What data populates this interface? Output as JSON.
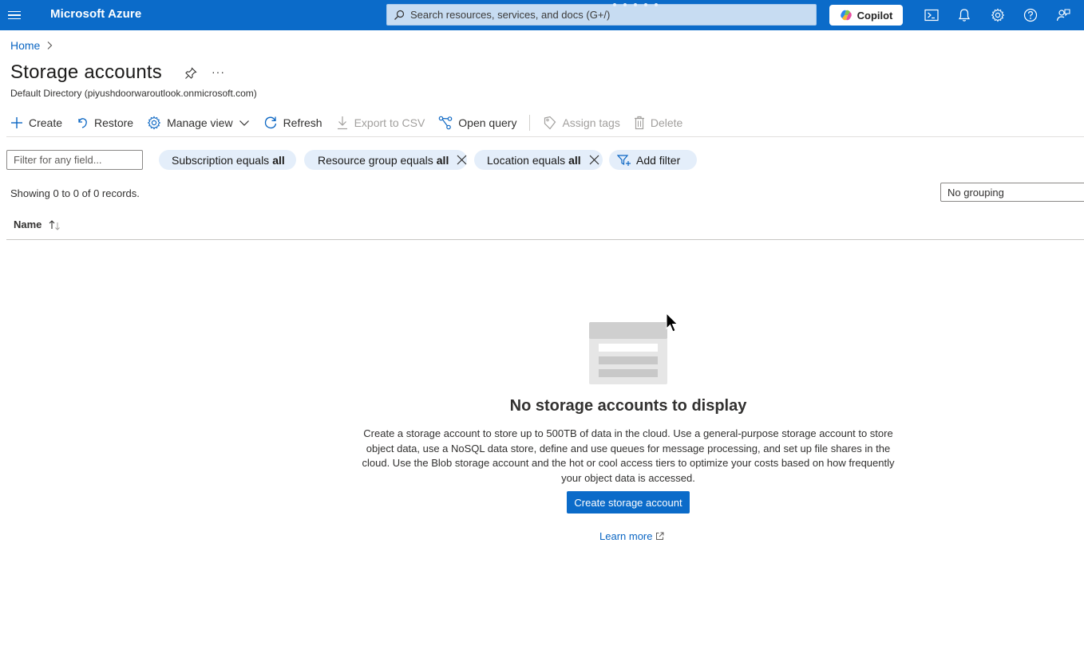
{
  "topbar": {
    "brand": "Microsoft Azure",
    "search_placeholder": "Search resources, services, and docs (G+/)",
    "copilot_label": "Copilot",
    "icons": [
      "menu-icon",
      "cloud-shell-icon",
      "notifications-icon",
      "settings-icon",
      "help-icon",
      "feedback-icon"
    ]
  },
  "breadcrumb": {
    "home": "Home"
  },
  "page": {
    "title": "Storage accounts",
    "subtitle": "Default Directory (piyushdoorwaroutlook.onmicrosoft.com)"
  },
  "commands": {
    "create": "Create",
    "restore": "Restore",
    "manage_view": "Manage view",
    "refresh": "Refresh",
    "export_csv": "Export to CSV",
    "open_query": "Open query",
    "assign_tags": "Assign tags",
    "delete": "Delete"
  },
  "filters": {
    "placeholder": "Filter for any field...",
    "subscription_label": "Subscription equals",
    "subscription_value": "all",
    "resource_group_label": "Resource group equals",
    "resource_group_value": "all",
    "location_label": "Location equals",
    "location_value": "all",
    "add_filter": "Add filter"
  },
  "list": {
    "showing": "Showing 0 to 0 of 0 records.",
    "grouping": "No grouping",
    "column_name": "Name"
  },
  "empty_state": {
    "title": "No storage accounts to display",
    "description": "Create a storage account to store up to 500TB of data in the cloud. Use a general-purpose storage account to store object data, use a NoSQL data store, define and use queues for message processing, and set up file shares in the cloud. Use the Blob storage account and the hot or cool access tiers to optimize your costs based on how frequently your object data is accessed.",
    "create_button": "Create storage account",
    "learn_more": "Learn more"
  },
  "colors": {
    "accent": "#0b6bc9",
    "link": "#0b66c3",
    "pill_bg": "#e4eefa"
  }
}
